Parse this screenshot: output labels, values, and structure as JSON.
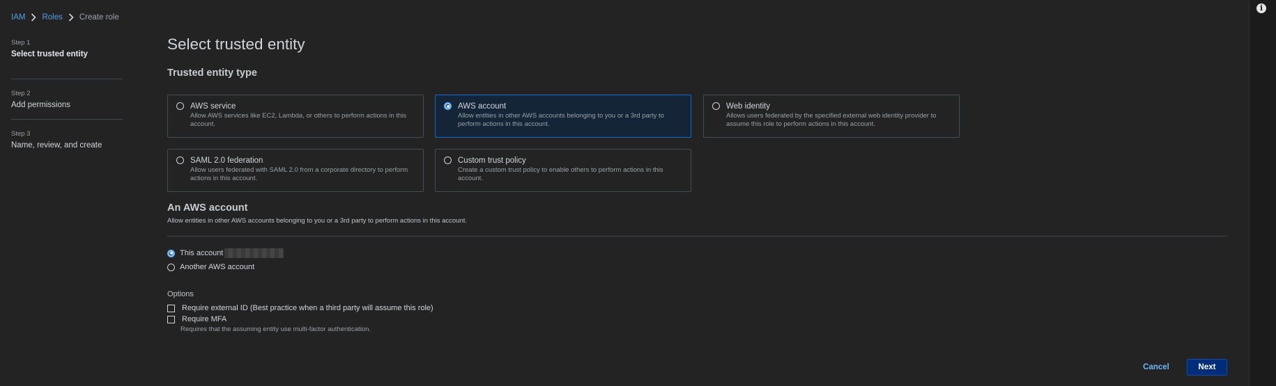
{
  "breadcrumb": {
    "root": "IAM",
    "parent": "Roles",
    "current": "Create role"
  },
  "steps": [
    {
      "num": "Step 1",
      "title": "Select trusted entity"
    },
    {
      "num": "Step 2",
      "title": "Add permissions"
    },
    {
      "num": "Step 3",
      "title": "Name, review, and create"
    }
  ],
  "page_title": "Select trusted entity",
  "section_title": "Trusted entity type",
  "tiles": [
    {
      "title": "AWS service",
      "desc": "Allow AWS services like EC2, Lambda, or others to perform actions in this account.",
      "selected": false
    },
    {
      "title": "AWS account",
      "desc": "Allow entities in other AWS accounts belonging to you or a 3rd party to perform actions in this account.",
      "selected": true
    },
    {
      "title": "Web identity",
      "desc": "Allows users federated by the specified external web identity provider to assume this role to perform actions in this account.",
      "selected": false
    },
    {
      "title": "SAML 2.0 federation",
      "desc": "Allow users federated with SAML 2.0 from a corporate directory to perform actions in this account.",
      "selected": false
    },
    {
      "title": "Custom trust policy",
      "desc": "Create a custom trust policy to enable others to perform actions in this account.",
      "selected": false
    }
  ],
  "aws_account": {
    "title": "An AWS account",
    "desc": "Allow entities in other AWS accounts belonging to you or a 3rd party to perform actions in this account.",
    "this_account": "This account",
    "another_account": "Another AWS account"
  },
  "options": {
    "label": "Options",
    "external_id": "Require external ID (Best practice when a third party will assume this role)",
    "mfa": "Require MFA",
    "mfa_desc": "Requires that the assuming entity use multi-factor authentication."
  },
  "buttons": {
    "cancel": "Cancel",
    "next": "Next"
  },
  "colors": {
    "accent": "#539fe5",
    "selected_border": "#0d6ad2",
    "primary_button": "#002d7a"
  },
  "icons": {
    "info": "info-icon",
    "chevron": "chevron-right-icon"
  }
}
